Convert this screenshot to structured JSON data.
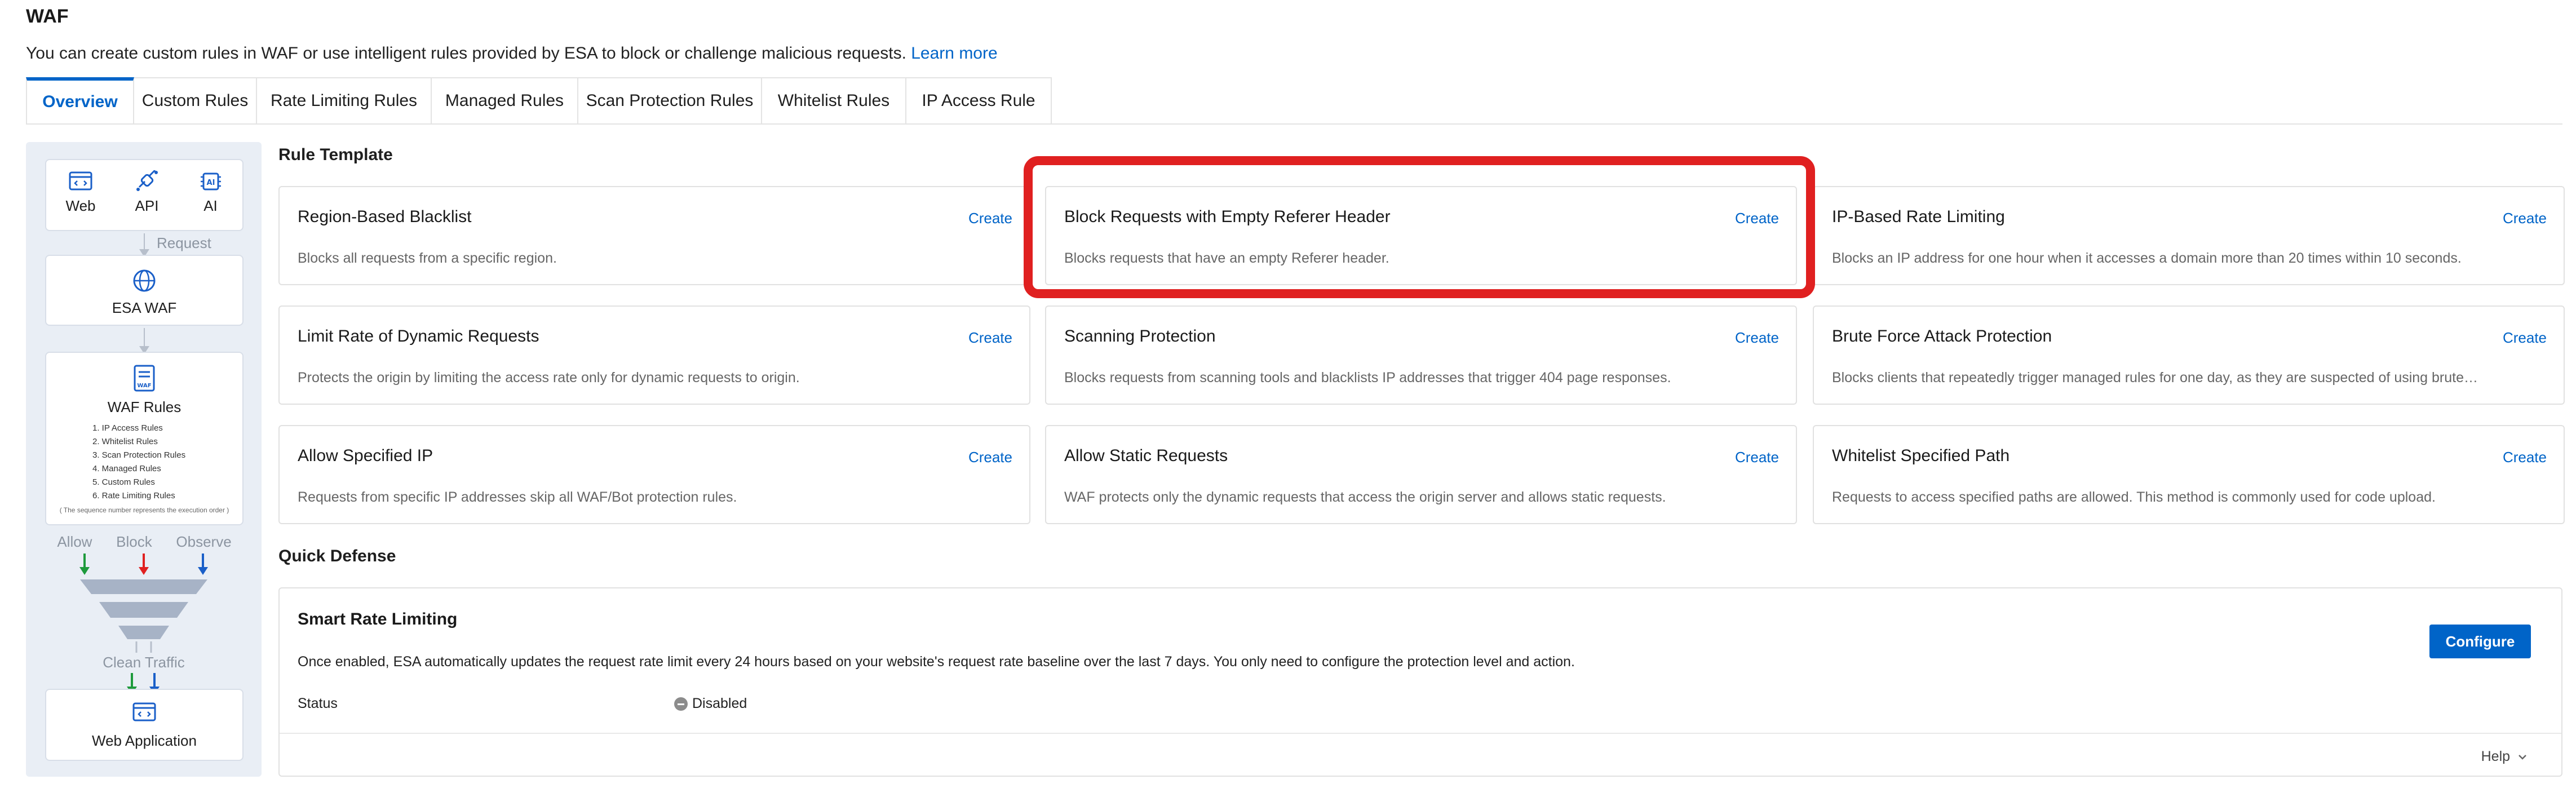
{
  "page": {
    "title": "WAF",
    "description": "You can create custom rules in WAF or use intelligent rules provided by ESA to block or challenge malicious requests.",
    "learn_more": "Learn more"
  },
  "tabs": [
    {
      "label": "Overview",
      "active": true
    },
    {
      "label": "Custom Rules"
    },
    {
      "label": "Rate Limiting Rules"
    },
    {
      "label": "Managed Rules"
    },
    {
      "label": "Scan Protection Rules"
    },
    {
      "label": "Whitelist Rules"
    },
    {
      "label": "IP Access Rule"
    }
  ],
  "diagram": {
    "clients": [
      "Web",
      "API",
      "AI"
    ],
    "request_label": "Request",
    "esa_waf": "ESA WAF",
    "waf_badge": "WAF",
    "waf_rules_title": "WAF Rules",
    "waf_rules_list": [
      "1. IP Access Rules",
      "2. Whitelist Rules",
      "3. Scan Protection Rules",
      "4. Managed Rules",
      "5. Custom Rules",
      "6. Rate Limiting Rules"
    ],
    "sequence_note": "( The sequence number represents the execution order )",
    "actions": [
      "Allow",
      "Block",
      "Observe"
    ],
    "clean_traffic": "Clean Traffic",
    "web_application": "Web Application"
  },
  "rule_template": {
    "title": "Rule Template",
    "create_label": "Create",
    "cards": [
      {
        "title": "Region-Based Blacklist",
        "desc": "Blocks all requests from a specific region."
      },
      {
        "title": "Block Requests with Empty Referer Header",
        "desc": "Blocks requests that have an empty Referer header."
      },
      {
        "title": "IP-Based Rate Limiting",
        "desc": "Blocks an IP address for one hour when it accesses a domain more than 20 times within 10 seconds."
      },
      {
        "title": "Limit Rate of Dynamic Requests",
        "desc": "Protects the origin by limiting the access rate only for dynamic requests to origin."
      },
      {
        "title": "Scanning Protection",
        "desc": "Blocks requests from scanning tools and blacklists IP addresses that trigger 404 page responses."
      },
      {
        "title": "Brute Force Attack Protection",
        "desc": "Blocks clients that repeatedly trigger managed rules for one day, as they are suspected of using brute…"
      },
      {
        "title": "Allow Specified IP",
        "desc": "Requests from specific IP addresses skip all WAF/Bot protection rules."
      },
      {
        "title": "Allow Static Requests",
        "desc": "WAF protects only the dynamic requests that access the origin server and allows static requests."
      },
      {
        "title": "Whitelist Specified Path",
        "desc": "Requests to access specified paths are allowed. This method is commonly used for code upload."
      }
    ]
  },
  "quick_defense": {
    "title": "Quick Defense",
    "card_title": "Smart Rate Limiting",
    "card_desc": "Once enabled, ESA automatically updates the request rate limit every 24 hours based on your website's request rate baseline over the last 7 days. You only need to configure the protection level and action.",
    "status_label": "Status",
    "status_value": "Disabled",
    "configure": "Configure",
    "help": "Help"
  },
  "colors": {
    "accent": "#0064c8",
    "highlight": "#e02020",
    "allow": "#1e9a3c",
    "block": "#e02020",
    "observe": "#1a5fc8"
  }
}
